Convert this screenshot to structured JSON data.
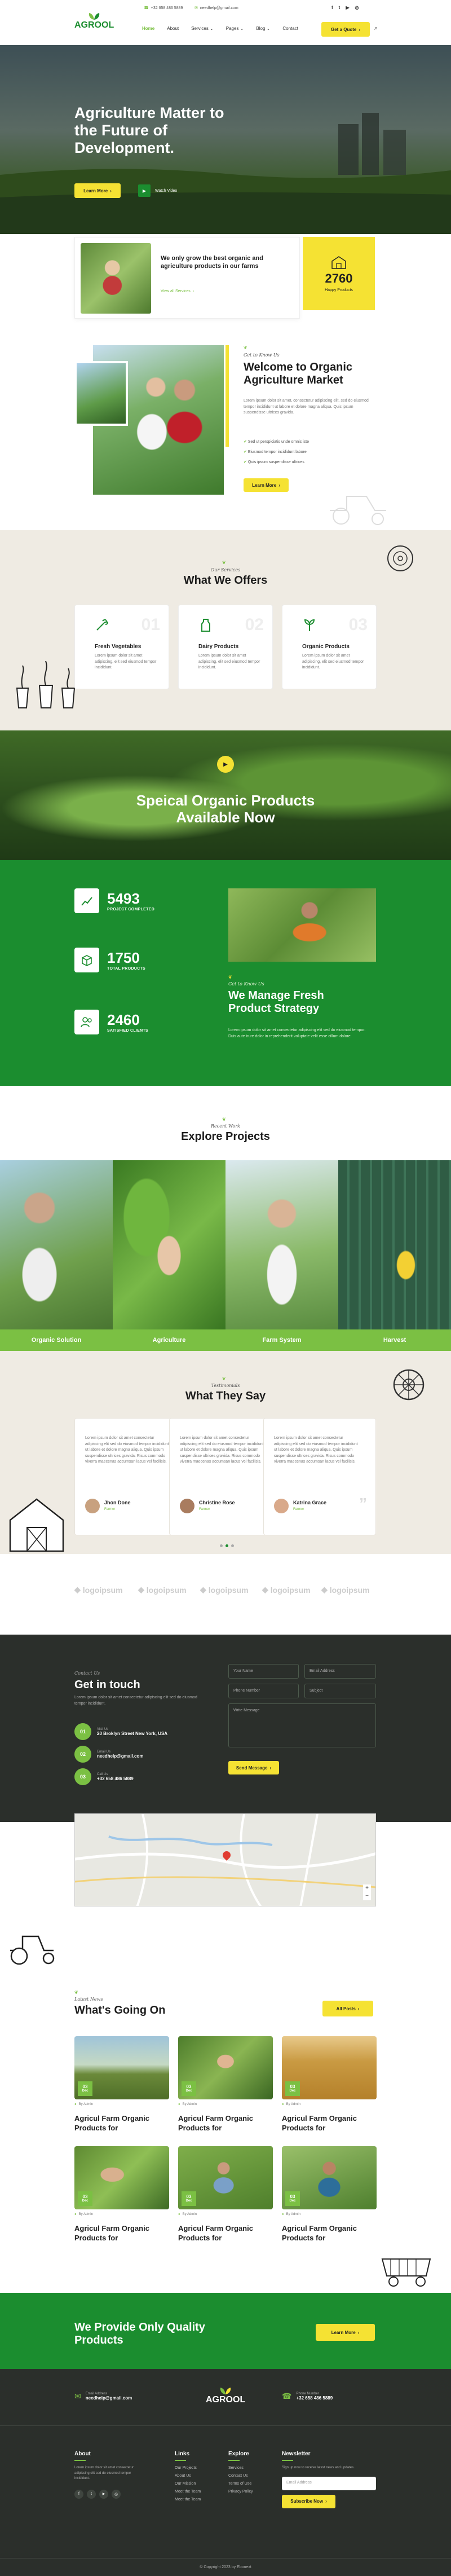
{
  "topbar": {
    "phone": "+32 658 486 5889",
    "email": "needhelp@gmail.com"
  },
  "header": {
    "logo": "AGROOL",
    "nav": [
      "Home",
      "About",
      "Services",
      "Pages",
      "Blog",
      "Contact"
    ],
    "cta": "Get a Quote"
  },
  "hero": {
    "title": "Agriculture Matter to the Future of Development.",
    "learn_more": "Learn More",
    "watch_video": "Watch Video"
  },
  "intro": {
    "text": "We only grow the best organic and agriculture products in our farms",
    "link": "View all Services",
    "count": "2760",
    "count_label": "Happy Products"
  },
  "welcome": {
    "script": "Get to Know Us",
    "title": "Welcome to Organic Agriculture Market",
    "text": "Lorem ipsum dolor sit amet, consectetur adipiscing elit, sed do eiusmod tempor incididunt ut labore et dolore magna aliqua. Quis ipsum suspendisse ultrices gravida.",
    "checks": [
      "Sed ut perspiciatis unde omnis iste",
      "Eiusmod tempor incididunt labore",
      "Quis ipsum suspendisse ultrices"
    ],
    "button": "Learn More"
  },
  "offers": {
    "script": "Our Services",
    "title": "What We Offers",
    "items": [
      {
        "num": "01",
        "title": "Fresh Vegetables",
        "text": "Lorem ipsum dolor sit amet adipiscing, elit sed eiusmod tempor incididunt."
      },
      {
        "num": "02",
        "title": "Dairy Products",
        "text": "Lorem ipsum dolor sit amet adipiscing, elit sed eiusmod tempor incididunt."
      },
      {
        "num": "03",
        "title": "Organic Products",
        "text": "Lorem ipsum dolor sit amet adipiscing, elit sed eiusmod tempor incididunt."
      }
    ]
  },
  "video": {
    "title": "Speical Organic Products Available Now"
  },
  "strategy": {
    "stats": [
      {
        "num": "5493",
        "label": "PROJECT COMPLETED"
      },
      {
        "num": "1750",
        "label": "TOTAL PRODUCTS"
      },
      {
        "num": "2460",
        "label": "SATISFIED CLIENTS"
      }
    ],
    "script": "Get to Know Us",
    "title": "We Manage Fresh Product Strategy",
    "text": "Lorem ipsum dolor sit amet consectetur adipiscing elit sed do eiusmod tempor. Duis aute irure dolor in reprehenderit voluptate velit esse cillum dolore."
  },
  "projects": {
    "script": "Recent Work",
    "title": "Explore Projects",
    "items": [
      "Organic Solution",
      "Agriculture",
      "Farm System",
      "Harvest"
    ]
  },
  "testimonials": {
    "script": "Testimonials",
    "title": "What They Say",
    "items": [
      {
        "text": "Lorem ipsum dolor sit amet consectetur adipiscing elit sed do eiusmod tempor incididunt ut labore et dolore magna aliqua. Quis ipsum suspendisse ultrices gravida. Risus commodo viverra maecenas accumsan lacus vel facilisis.",
        "name": "Jhon Done",
        "role": "Farmer"
      },
      {
        "text": "Lorem ipsum dolor sit amet consectetur adipiscing elit sed do eiusmod tempor incididunt ut labore et dolore magna aliqua. Quis ipsum suspendisse ultrices gravida. Risus commodo viverra maecenas accumsan lacus vel facilisis.",
        "name": "Christine Rose",
        "role": "Farmer"
      },
      {
        "text": "Lorem ipsum dolor sit amet consectetur adipiscing elit sed do eiusmod tempor incididunt ut labore et dolore magna aliqua. Quis ipsum suspendisse ultrices gravida. Risus commodo viverra maecenas accumsan lacus vel facilisis.",
        "name": "Katrina Grace",
        "role": "Farmer"
      }
    ]
  },
  "brands": [
    "logoipsum",
    "logoipsum",
    "logoipsum",
    "logoipsum",
    "logoipsum"
  ],
  "contact": {
    "script": "Contact Us",
    "title": "Get in touch",
    "text": "Lorem ipsum dolor sit amet consectetur adipiscing elit sed do eiusmod tempor incididunt.",
    "items": [
      {
        "num": "01",
        "label": "Visit Us",
        "value": "20 Broklyn Street New York, USA"
      },
      {
        "num": "02",
        "label": "Email Us",
        "value": "needhelp@gmail.com"
      },
      {
        "num": "03",
        "label": "Call Us",
        "value": "+32 658 486 5889"
      }
    ],
    "fields": {
      "name": "Your Name",
      "email": "Email Address",
      "phone": "Phone Number",
      "subject": "Subject",
      "message": "Write Message"
    },
    "button": "Send Message"
  },
  "blog": {
    "script": "Latest News",
    "title": "What's Going On",
    "button": "All Posts",
    "posts": [
      {
        "day": "03",
        "mon": "Dec",
        "meta": "By Admin",
        "title": "Agricul Farm Organic Products for"
      },
      {
        "day": "03",
        "mon": "Dec",
        "meta": "By Admin",
        "title": "Agricul Farm Organic Products for"
      },
      {
        "day": "03",
        "mon": "Dec",
        "meta": "By Admin",
        "title": "Agricul Farm Organic Products for"
      },
      {
        "day": "03",
        "mon": "Dec",
        "meta": "By Admin",
        "title": "Agricul Farm Organic Products for"
      },
      {
        "day": "03",
        "mon": "Dec",
        "meta": "By Admin",
        "title": "Agricul Farm Organic Products for"
      },
      {
        "day": "03",
        "mon": "Dec",
        "meta": "By Admin",
        "title": "Agricul Farm Organic Products for"
      }
    ]
  },
  "cta": {
    "title": "We Provide Only Quality Products",
    "button": "Learn More"
  },
  "footer": {
    "email_label": "Email Address",
    "email": "needhelp@gmail.com",
    "phone_label": "Phone Number",
    "phone": "+32 658 486 5889",
    "logo": "AGROOL",
    "about_title": "About",
    "about_text": "Lorem ipsum dolor sit amet consectetur adipiscing elit sed do eiusmod tempor incididunt.",
    "links_title": "Links",
    "links": [
      "Our Projects",
      "About Us",
      "Our Mission",
      "Meet the Team",
      "Meet the Team"
    ],
    "explore_title": "Explore",
    "explore": [
      "Services",
      "Contact Us",
      "Terms of Use",
      "Privacy Policy"
    ],
    "news_title": "Newsletter",
    "news_text": "Sign up now to receive latest news and updates.",
    "news_placeholder": "Email Address",
    "news_button": "Subscribe Now",
    "copyright": "© Copyright 2023 by Ebonext"
  },
  "colors": {
    "green": "#1b8d2f",
    "light_green": "#7bc043",
    "yellow": "#f5e233",
    "dark": "#2b2f2b",
    "beige": "#efebe3"
  }
}
